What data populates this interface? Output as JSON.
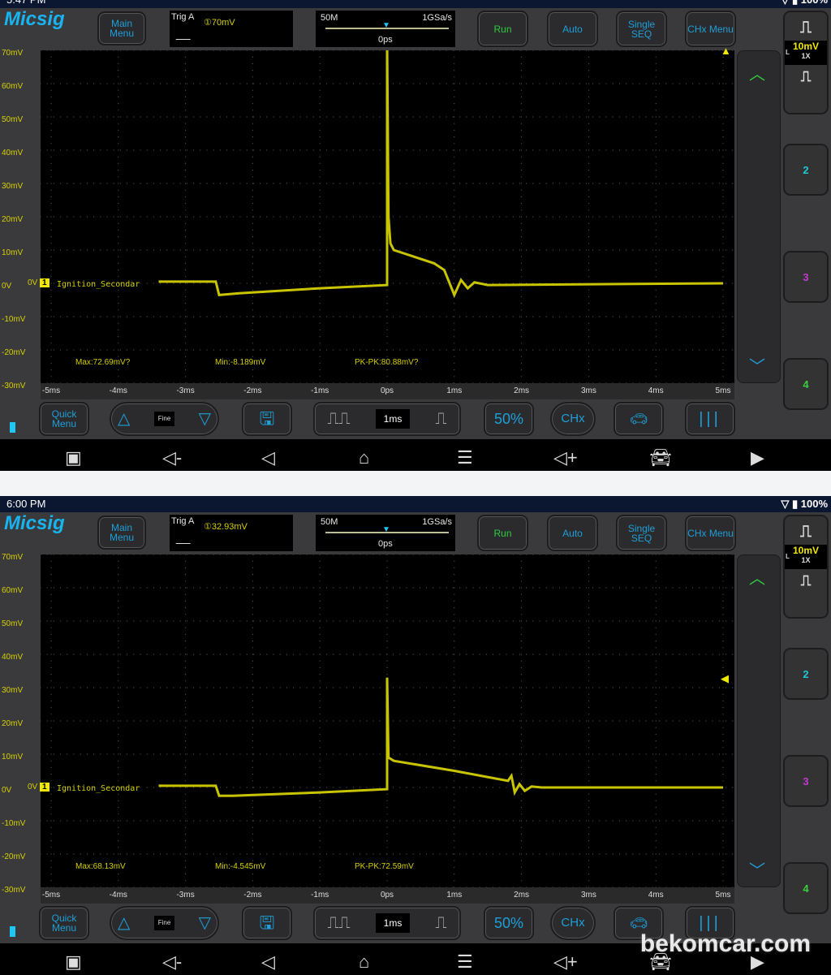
{
  "screens": [
    {
      "status_time": "5:47 PM",
      "battery": "100%",
      "logo": "Micsig",
      "main_menu": "Main Menu",
      "trig_label": "Trig A",
      "trig_level": "①70mV",
      "mem_depth": "50M",
      "sample_rate": "1GSa/s",
      "time_offset": "0ps",
      "run": "Run",
      "auto": "Auto",
      "single": "Single SEQ",
      "chx_menu": "CHx Menu",
      "y_ticks": [
        "70mV",
        "60mV",
        "50mV",
        "40mV",
        "30mV",
        "20mV",
        "10mV",
        "0V",
        "-10mV",
        "-20mV",
        "-30mV"
      ],
      "x_ticks": [
        "-5ms",
        "-4ms",
        "-3ms",
        "-2ms",
        "-1ms",
        "0ps",
        "1ms",
        "2ms",
        "3ms",
        "4ms",
        "5ms"
      ],
      "channel_label": "Ignition_Secondar",
      "channel_num": "1",
      "max": "Max:72.69mV?",
      "min": "Min:-8.189mV",
      "pkpk": "PK-PK:80.88mV?",
      "quick_menu": "Quick Menu",
      "fine": "Fine",
      "timebase": "1ms",
      "fifty": "50%",
      "chx": "CHx",
      "volt_div": "10mV",
      "probe": "1X",
      "coupling": "L",
      "ch2": "2",
      "ch3": "3",
      "ch4": "4",
      "trigger_mv": 70,
      "trace": [
        [
          -5,
          null
        ],
        [
          -3.4,
          0.5
        ],
        [
          -2.55,
          0.5
        ],
        [
          -2.5,
          -3.5
        ],
        [
          -2.2,
          -3
        ],
        [
          -1,
          -1.5
        ],
        [
          0,
          -0.5
        ],
        [
          0,
          72
        ],
        [
          0.02,
          20
        ],
        [
          0.05,
          12
        ],
        [
          0.1,
          10
        ],
        [
          0.4,
          8
        ],
        [
          0.7,
          6
        ],
        [
          0.85,
          4
        ],
        [
          0.95,
          -1
        ],
        [
          1.0,
          -3.5
        ],
        [
          1.1,
          1
        ],
        [
          1.2,
          -1.5
        ],
        [
          1.3,
          0.3
        ],
        [
          1.5,
          -0.5
        ],
        [
          5,
          0
        ]
      ]
    },
    {
      "status_time": "6:00 PM",
      "battery": "100%",
      "logo": "Micsig",
      "main_menu": "Main Menu",
      "trig_label": "Trig A",
      "trig_level": "①32.93mV",
      "mem_depth": "50M",
      "sample_rate": "1GSa/s",
      "time_offset": "0ps",
      "run": "Run",
      "auto": "Auto",
      "single": "Single SEQ",
      "chx_menu": "CHx Menu",
      "y_ticks": [
        "70mV",
        "60mV",
        "50mV",
        "40mV",
        "30mV",
        "20mV",
        "10mV",
        "0V",
        "-10mV",
        "-20mV",
        "-30mV"
      ],
      "x_ticks": [
        "-5ms",
        "-4ms",
        "-3ms",
        "-2ms",
        "-1ms",
        "0ps",
        "1ms",
        "2ms",
        "3ms",
        "4ms",
        "5ms"
      ],
      "channel_label": "Ignition_Secondar",
      "channel_num": "1",
      "max": "Max:68.13mV",
      "min": "Min:-4.545mV",
      "pkpk": "PK-PK:72.59mV",
      "quick_menu": "Quick Menu",
      "fine": "Fine",
      "timebase": "1ms",
      "fifty": "50%",
      "chx": "CHx",
      "volt_div": "10mV",
      "probe": "1X",
      "coupling": "L",
      "ch2": "2",
      "ch3": "3",
      "ch4": "4",
      "trigger_mv": 32.93,
      "trace": [
        [
          -3.4,
          0.5
        ],
        [
          -2.55,
          0.5
        ],
        [
          -2.5,
          -2.5
        ],
        [
          -2.3,
          -2.5
        ],
        [
          -1,
          -1.5
        ],
        [
          0,
          -0.5
        ],
        [
          0,
          33
        ],
        [
          0.02,
          9
        ],
        [
          0.1,
          8
        ],
        [
          1.0,
          5
        ],
        [
          1.8,
          2
        ],
        [
          1.85,
          3.5
        ],
        [
          1.9,
          -1.5
        ],
        [
          1.97,
          1
        ],
        [
          2.05,
          -1
        ],
        [
          2.15,
          0.3
        ],
        [
          2.3,
          0
        ],
        [
          5,
          0
        ]
      ]
    }
  ],
  "colors": {
    "trace": "#c9c400",
    "accent": "#1e9fd8",
    "run": "#2ecc40",
    "ch2": "#1ec8d8",
    "ch3": "#c43ad0",
    "ch4": "#3ccf3c"
  },
  "watermark": "bekomcar.com"
}
